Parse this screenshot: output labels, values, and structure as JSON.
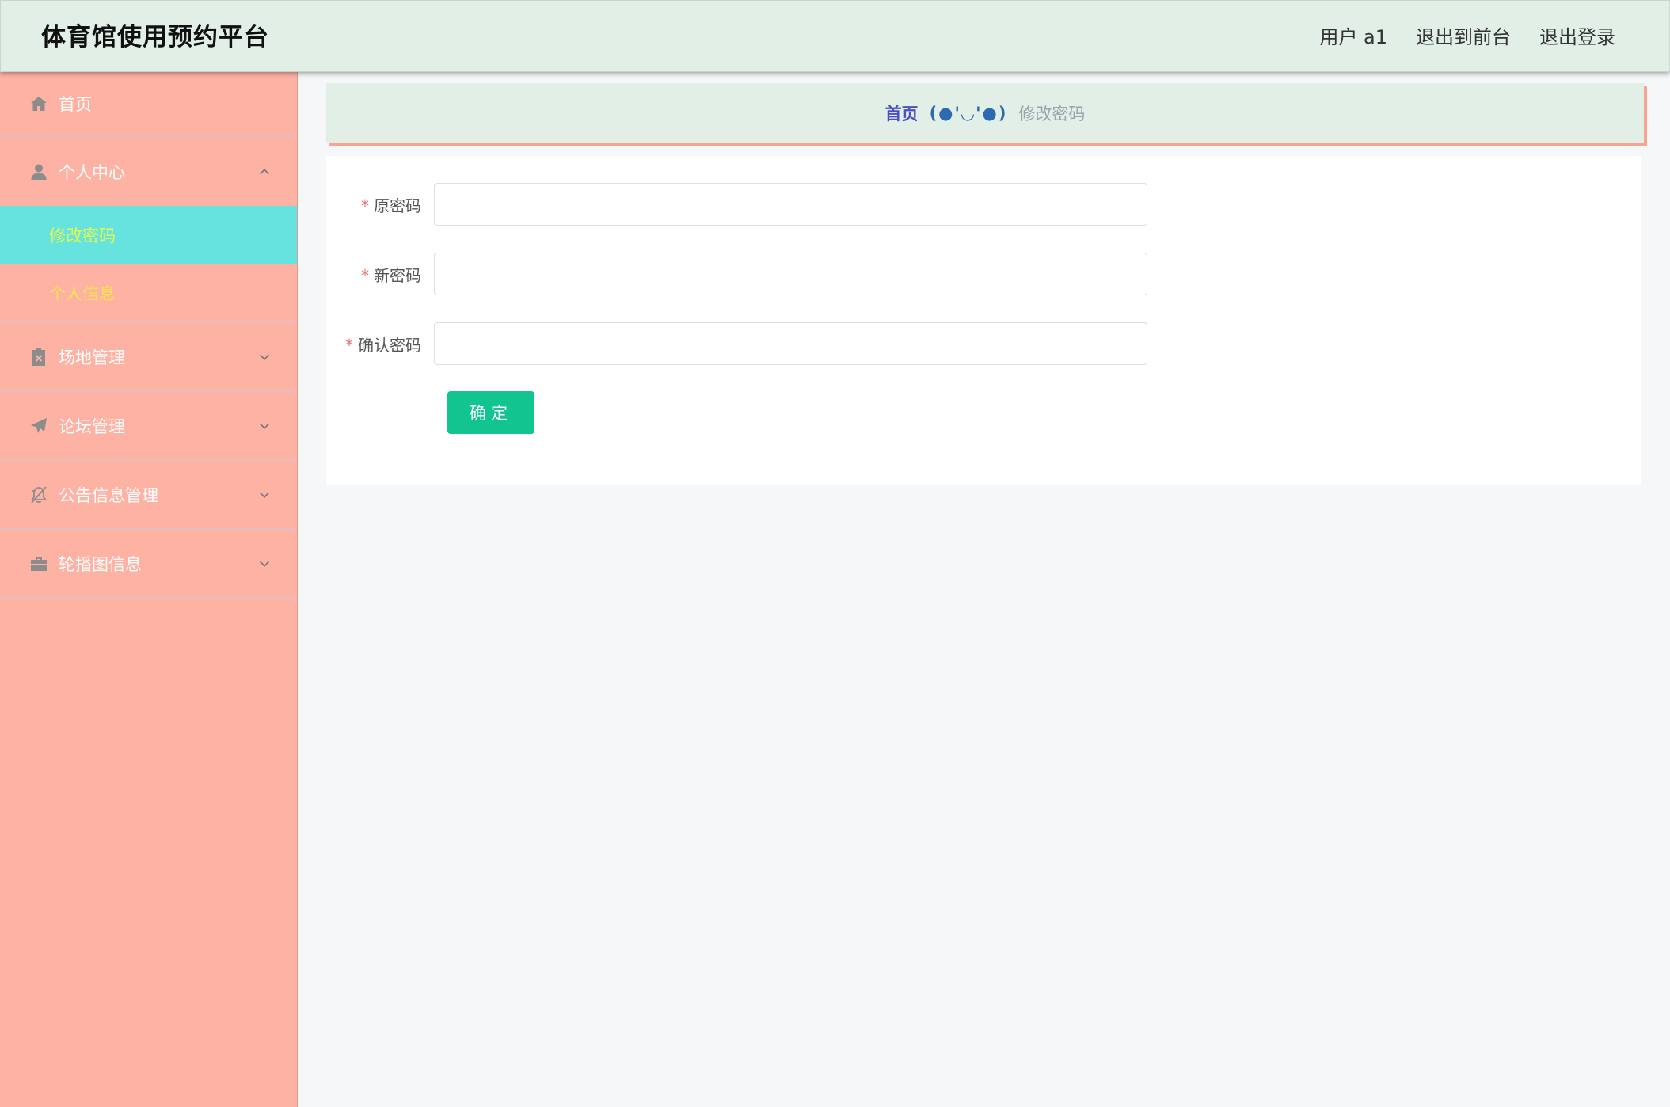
{
  "header": {
    "title": "体育馆使用预约平台",
    "user_label": "用户 a1",
    "to_front_label": "退出到前台",
    "logout_label": "退出登录"
  },
  "sidebar": {
    "items": [
      {
        "label": "首页",
        "icon": "home-icon"
      },
      {
        "label": "个人中心",
        "icon": "user-icon",
        "expanded": true,
        "children": [
          {
            "label": "修改密码",
            "active": true
          },
          {
            "label": "个人信息",
            "active": false
          }
        ]
      },
      {
        "label": "场地管理",
        "icon": "clipboard-icon"
      },
      {
        "label": "论坛管理",
        "icon": "paper-plane-icon"
      },
      {
        "label": "公告信息管理",
        "icon": "bell-off-icon"
      },
      {
        "label": "轮播图信息",
        "icon": "briefcase-icon"
      }
    ]
  },
  "breadcrumb": {
    "home": "首页",
    "separator": "(●'◡'●)",
    "current": "修改密码"
  },
  "form": {
    "required_mark": "*",
    "old_password_label": "原密码",
    "new_password_label": "新密码",
    "confirm_password_label": "确认密码",
    "old_password_value": "",
    "new_password_value": "",
    "confirm_password_value": "",
    "submit_label": "确定"
  },
  "colors": {
    "header_bg": "#e1efe7",
    "sidebar_bg": "#feb2a4",
    "active_sub_bg": "#66e3df",
    "sub_text": "#f5e54a",
    "submit_bg": "#12c490",
    "required": "#f56c6c"
  }
}
